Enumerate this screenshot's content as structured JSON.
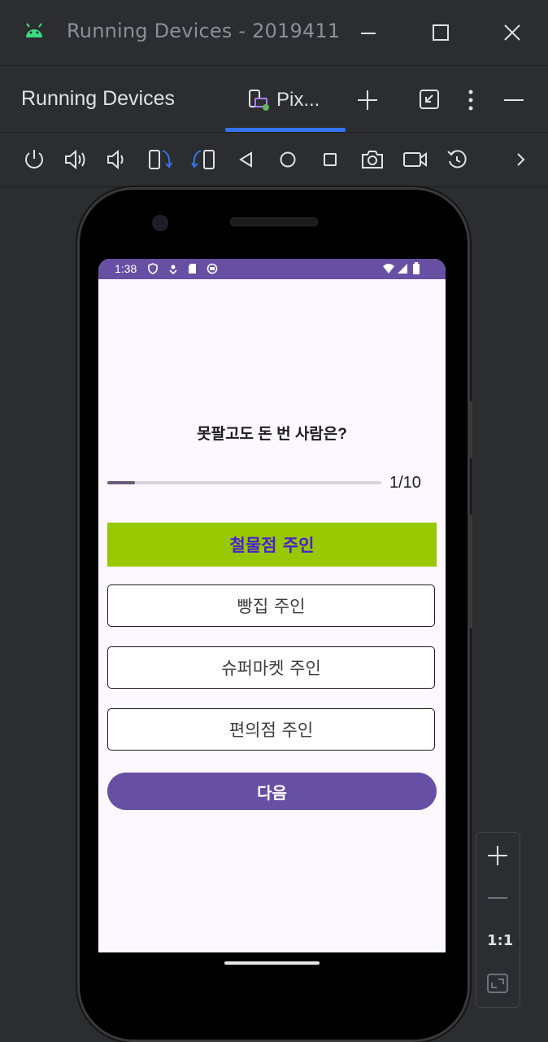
{
  "window": {
    "title": "Running Devices - 2019411"
  },
  "toolwindow": {
    "title": "Running Devices",
    "tab_label": "Pix..."
  },
  "device_toolbar": {
    "icons": [
      "power-icon",
      "volume-up-icon",
      "volume-down-icon",
      "rotate-left-icon",
      "rotate-right-icon",
      "back-icon",
      "home-icon",
      "overview-icon",
      "screenshot-icon",
      "screen-record-icon",
      "reset-icon",
      "more-chevron-icon"
    ]
  },
  "status_bar": {
    "time": "1:38"
  },
  "quiz": {
    "question": "못팔고도 돈 번 사람은?",
    "progress": {
      "current": 1,
      "total": 10,
      "text": "1/10",
      "fraction": 0.1
    },
    "options": [
      {
        "label": "철물점 주인",
        "selected": true
      },
      {
        "label": "빵집 주인",
        "selected": false
      },
      {
        "label": "슈퍼마켓 주인",
        "selected": false
      },
      {
        "label": "편의점 주인",
        "selected": false
      }
    ],
    "next_label": "다음"
  },
  "zoom": {
    "one_to_one": "1:1"
  },
  "colors": {
    "accent": "#3574f0",
    "primary": "#6750a4",
    "selected_option": "#97c800",
    "selected_text": "#4a1fd0"
  }
}
